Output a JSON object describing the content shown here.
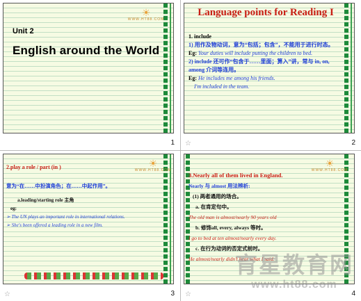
{
  "logo": {
    "sun": "☀",
    "text": "WWW.HT88.COM"
  },
  "slide1": {
    "unit": "Unit 2",
    "title": "English around the World",
    "number": "1"
  },
  "slide2": {
    "title": "Language points for Reading I",
    "l1": "1. include",
    "l2": "1) 用作及物动词，意为“包括；包含”，不能用于进行时态。",
    "l3_label": "Eg:",
    "l3": "Your duties will include putting the children to bed.",
    "l4": "2) include 还可作“包含于……里面；算入”讲，常与 in, on, among 介词等连用。",
    "l5_label": "Eg:",
    "l5": "He includes me among his friends.",
    "l6": "I'm included in the team.",
    "number": "2",
    "star": "☆"
  },
  "slide3": {
    "head": "2.play a role / part (in )",
    "def": "意为“在……中扮演角色；在……中起作用”。",
    "l1": "a.leading/starting role 主角",
    "l2": "eg:",
    "b1": "The UN plays an important role in international relations.",
    "b2": "She's been offered a leading role in a new film.",
    "bullet": "➢",
    "number": "3",
    "star": "☆"
  },
  "slide4": {
    "head": "3.Nearly all of them lived in England.",
    "l1": "Nearly 与 almost 用法辨析:",
    "l2": "(1) 两者通用的场合。",
    "l3": "a. 在肯定句中。",
    "l4": "The old man is almost/nearly 90 years old",
    "l5": "b. 修饰all, every, always 等时。",
    "l6": "I go to bed at ten almost/nearly every day.",
    "l7": "c. 在行为动词的否定式前时。",
    "l8": "He almost/nearly didn't hear what I said.",
    "number": "4",
    "star": "☆"
  },
  "watermark": {
    "line1": "育星教育网",
    "line2": "www.ht88.com"
  }
}
